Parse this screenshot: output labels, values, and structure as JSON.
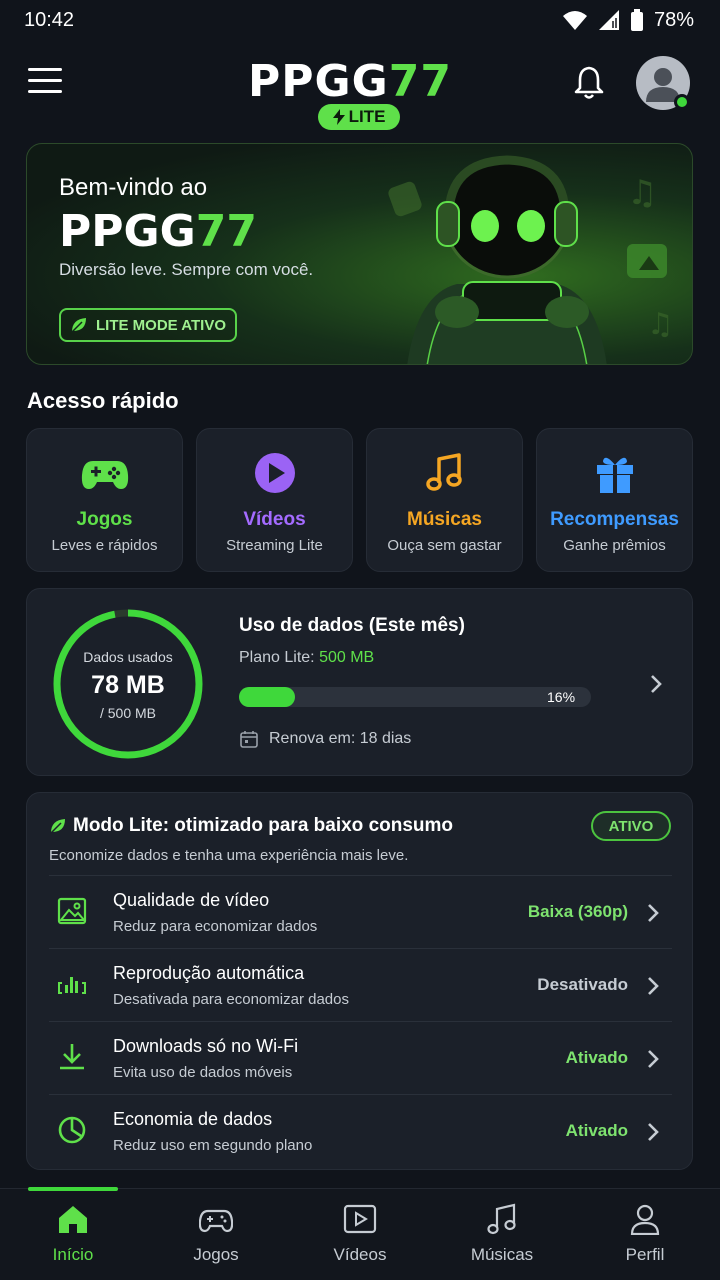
{
  "status": {
    "time": "10:42",
    "battery": "78%"
  },
  "header": {
    "logo_main": "PPGG",
    "logo_num": "77",
    "badge": "LITE"
  },
  "hero": {
    "welcome": "Bem-vindo ao",
    "logo_main": "PPGG",
    "logo_num": "77",
    "subtitle": "Diversão leve. Sempre com você.",
    "mode_pill": "LITE MODE ATIVO"
  },
  "quick_access": {
    "title": "Acesso rápido",
    "items": [
      {
        "title": "Jogos",
        "subtitle": "Leves e rápidos",
        "color": "#5fe04a",
        "icon": "gamepad-icon"
      },
      {
        "title": "Vídeos",
        "subtitle": "Streaming Lite",
        "color": "#a46bff",
        "icon": "play-icon"
      },
      {
        "title": "Músicas",
        "subtitle": "Ouça sem gastar",
        "color": "#f5a623",
        "icon": "music-icon"
      },
      {
        "title": "Recompensas",
        "subtitle": "Ganhe prêmios",
        "color": "#3f9bff",
        "icon": "gift-icon"
      }
    ]
  },
  "data_usage": {
    "ring_label": "Dados usados",
    "used": "78 MB",
    "total": "/ 500 MB",
    "title": "Uso de dados (Este mês)",
    "plan_label": "Plano Lite:",
    "plan_value": "500 MB",
    "percent_label": "16%",
    "percent": 16,
    "renew": "Renova em: 18 dias"
  },
  "lite_mode": {
    "title": "Modo Lite: otimizado para baixo consumo",
    "description": "Economize dados e tenha uma experiência mais leve.",
    "status": "ATIVO",
    "rows": [
      {
        "title": "Qualidade de vídeo",
        "subtitle": "Reduz para economizar dados",
        "value": "Baixa (360p)",
        "value_color": "#7ee36f",
        "icon": "image-icon"
      },
      {
        "title": "Reprodução automática",
        "subtitle": "Desativada para economizar dados",
        "value": "Desativado",
        "value_color": "#c6ccd3",
        "icon": "autoplay-icon"
      },
      {
        "title": "Downloads só no Wi-Fi",
        "subtitle": "Evita uso de dados móveis",
        "value": "Ativado",
        "value_color": "#7ee36f",
        "icon": "download-icon"
      },
      {
        "title": "Economia de dados",
        "subtitle": "Reduz uso em segundo plano",
        "value": "Ativado",
        "value_color": "#7ee36f",
        "icon": "data-saver-icon"
      }
    ]
  },
  "nav": {
    "items": [
      {
        "label": "Início",
        "icon": "home-icon",
        "active": true
      },
      {
        "label": "Jogos",
        "icon": "gamepad-icon"
      },
      {
        "label": "Vídeos",
        "icon": "video-icon"
      },
      {
        "label": "Músicas",
        "icon": "music-icon"
      },
      {
        "label": "Perfil",
        "icon": "user-icon"
      }
    ]
  }
}
